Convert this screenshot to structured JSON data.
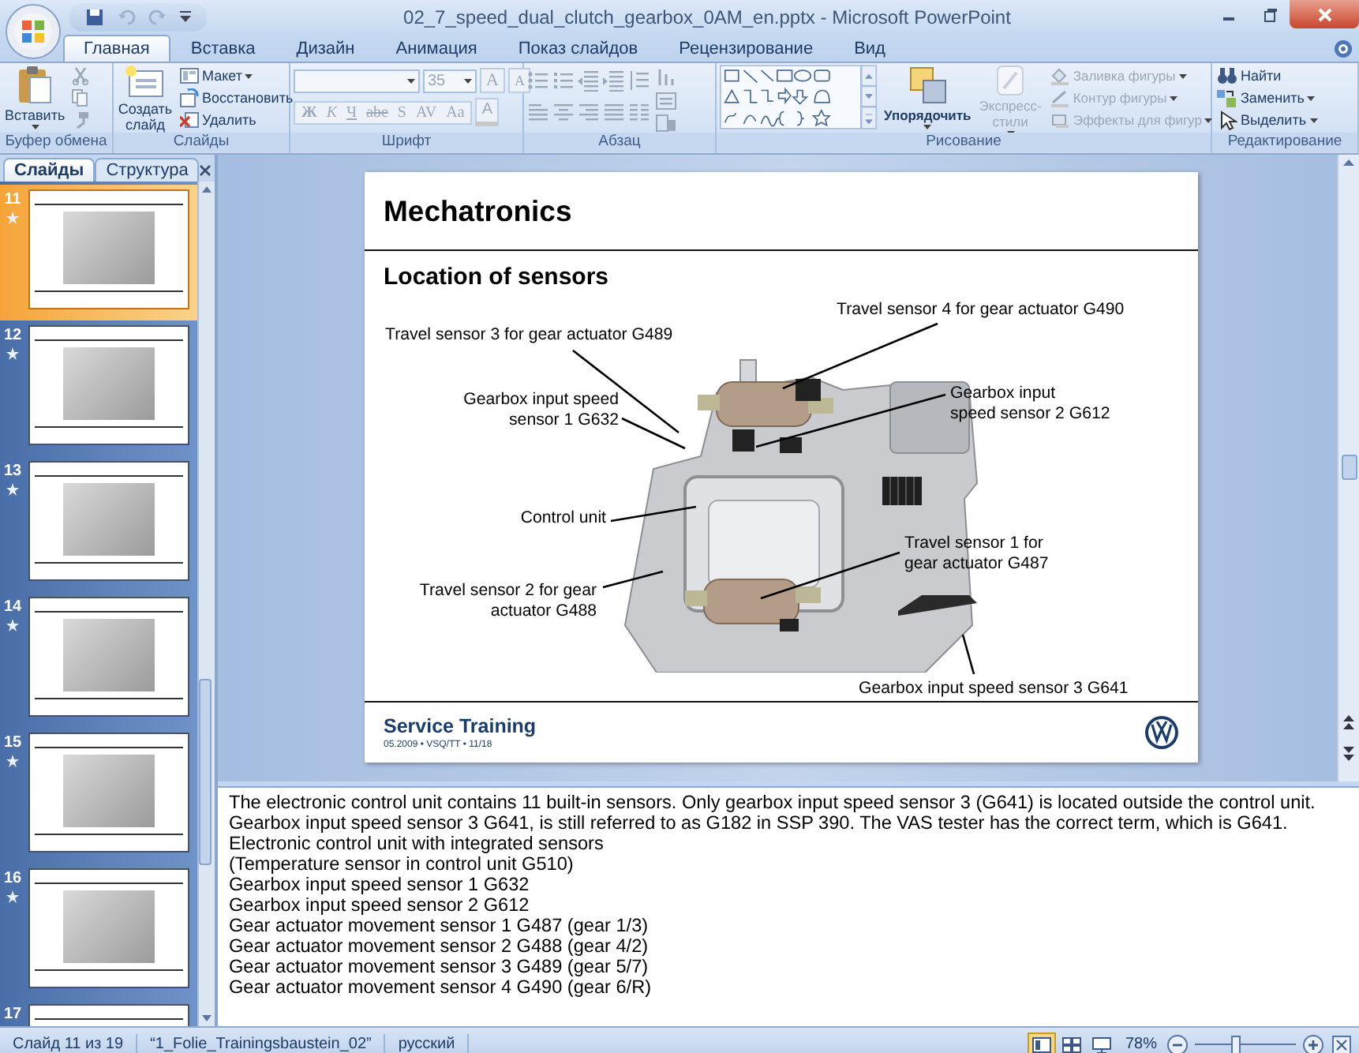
{
  "window": {
    "title": "02_7_speed_dual_clutch_gearbox_0AM_en.pptx - Microsoft PowerPoint"
  },
  "ribbon": {
    "tabs": [
      {
        "label": "Главная",
        "selected": true
      },
      {
        "label": "Вставка",
        "selected": false
      },
      {
        "label": "Дизайн",
        "selected": false
      },
      {
        "label": "Анимация",
        "selected": false
      },
      {
        "label": "Показ слайдов",
        "selected": false
      },
      {
        "label": "Рецензирование",
        "selected": false
      },
      {
        "label": "Вид",
        "selected": false
      }
    ],
    "groups": [
      {
        "kind": "clipboard",
        "label": "Буфер обмена",
        "paste": {
          "label": "Вставить"
        }
      },
      {
        "kind": "slides",
        "label": "Слайды",
        "new_slide": {
          "label": "Создать слайд"
        },
        "commands": [
          {
            "label": "Макет",
            "dropdown": true
          },
          {
            "label": "Восстановить",
            "dropdown": false
          },
          {
            "label": "Удалить",
            "dropdown": false
          }
        ]
      },
      {
        "kind": "font",
        "label": "Шрифт",
        "disabled": true,
        "font_size": "35",
        "size_buttons": [
          "A",
          "A"
        ],
        "format_buttons": [
          "Ж",
          "К",
          "Ч",
          "abe",
          "S",
          "AV",
          "Aa"
        ],
        "color_button": "A"
      },
      {
        "kind": "paragraph",
        "label": "Абзац",
        "disabled": true
      },
      {
        "kind": "drawing",
        "label": "Рисование",
        "arrange": {
          "label": "Упорядочить",
          "disabled": false
        },
        "quick_styles": {
          "label": "Экспресс-стили",
          "disabled": true
        },
        "commands": [
          {
            "label": "Заливка фигуры",
            "dropdown": true,
            "disabled": true
          },
          {
            "label": "Контур фигуры",
            "dropdown": true,
            "disabled": true
          },
          {
            "label": "Эффекты для фигур",
            "dropdown": true,
            "disabled": true
          }
        ]
      },
      {
        "kind": "editing",
        "label": "Редактирование",
        "commands": [
          {
            "label": "Найти",
            "dropdown": false
          },
          {
            "label": "Заменить",
            "dropdown": true
          },
          {
            "label": "Выделить",
            "dropdown": true
          }
        ]
      }
    ]
  },
  "slides_pane": {
    "tabs": [
      {
        "label": "Слайды",
        "selected": true
      },
      {
        "label": "Структура",
        "selected": false
      }
    ],
    "thumbnails": [
      {
        "number": "11",
        "selected": true
      },
      {
        "number": "12",
        "selected": false
      },
      {
        "number": "13",
        "selected": false
      },
      {
        "number": "14",
        "selected": false
      },
      {
        "number": "15",
        "selected": false
      },
      {
        "number": "16",
        "selected": false
      },
      {
        "number": "17",
        "selected": false
      }
    ]
  },
  "slide": {
    "title": "Mechatronics",
    "subtitle": "Location of sensors",
    "callouts": [
      {
        "lines": [
          "Travel sensor 4 for gear actuator G490"
        ]
      },
      {
        "lines": [
          "Travel sensor 3 for gear actuator G489"
        ]
      },
      {
        "lines": [
          "Gearbox input speed",
          "sensor 1 G632"
        ]
      },
      {
        "lines": [
          "Gearbox input",
          "speed sensor 2 G612"
        ]
      },
      {
        "lines": [
          "Control unit"
        ]
      },
      {
        "lines": [
          "Travel sensor 1 for",
          "gear actuator G487"
        ]
      },
      {
        "lines": [
          "Travel sensor 2 for gear",
          "actuator G488"
        ]
      },
      {
        "lines": [
          "Gearbox input speed sensor 3 G641"
        ]
      }
    ],
    "footer": {
      "brand": "Service Training",
      "info": "05.2009 • VSQ/TT • 11/18"
    }
  },
  "notes": {
    "lines": [
      "The electronic control unit contains 11 built-in sensors. Only gearbox input speed sensor 3 (G641) is located outside the control unit.",
      "Gearbox input speed sensor 3 G641, is still referred to as G182 in SSP 390. The VAS tester has the correct term, which is G641.",
      "Electronic control unit with integrated sensors",
      "(Temperature sensor in control unit G510)",
      "Gearbox input speed sensor 1 G632",
      "Gearbox input speed sensor 2 G612",
      "Gear actuator movement sensor 1 G487 (gear 1/3)",
      "Gear actuator movement sensor 2 G488 (gear 4/2)",
      "Gear actuator movement sensor 3 G489 (gear 5/7)",
      "Gear actuator movement sensor 4 G490 (gear 6/R)"
    ]
  },
  "status_bar": {
    "slide_info": "Слайд 11 из 19",
    "theme": "“1_Folie_Trainingsbaustein_02”",
    "language": "русский",
    "views": [
      {
        "kind": "normal",
        "selected": true
      },
      {
        "kind": "sorter",
        "selected": false
      },
      {
        "kind": "show",
        "selected": false
      }
    ],
    "zoom": "78%",
    "zoom_slider": {
      "level": 0.4
    }
  }
}
